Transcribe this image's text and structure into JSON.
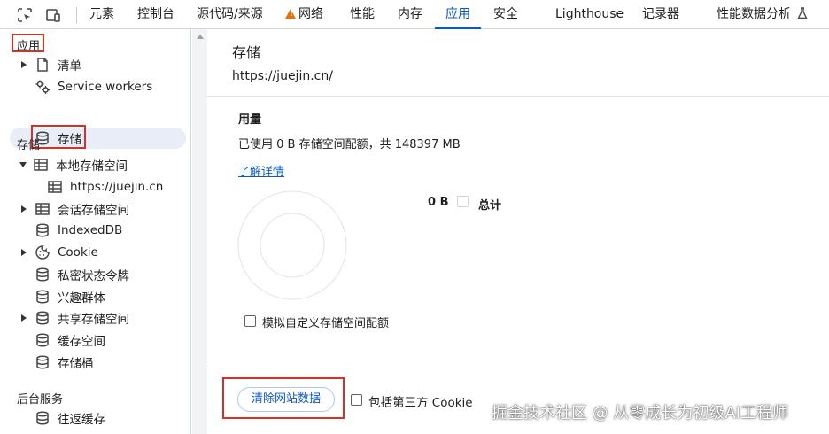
{
  "toolbar": {
    "tabs": [
      {
        "label": "元素"
      },
      {
        "label": "控制台"
      },
      {
        "label": "源代码/来源"
      },
      {
        "label": "网络"
      },
      {
        "label": "性能"
      },
      {
        "label": "内存"
      },
      {
        "label": "应用"
      },
      {
        "label": "安全"
      },
      {
        "label": "Lighthouse"
      },
      {
        "label": "记录器"
      },
      {
        "label": "性能数据分析"
      }
    ],
    "active_tab": "应用"
  },
  "sidebar": {
    "app_section": "应用",
    "app_items": [
      {
        "label": "清单"
      },
      {
        "label": "Service workers"
      },
      {
        "label": "存储"
      }
    ],
    "storage_section": "存储",
    "storage_items": [
      {
        "label": "本地存储空间"
      },
      {
        "label": "https://juejin.cn"
      },
      {
        "label": "会话存储空间"
      },
      {
        "label": "IndexedDB"
      },
      {
        "label": "Cookie"
      },
      {
        "label": "私密状态令牌"
      },
      {
        "label": "兴趣群体"
      },
      {
        "label": "共享存储空间"
      },
      {
        "label": "缓存空间"
      },
      {
        "label": "存储桶"
      }
    ],
    "background_section": "后台服务",
    "background_items": [
      {
        "label": "往返缓存"
      }
    ]
  },
  "main": {
    "title": "存储",
    "origin": "https://juejin.cn/",
    "usage": {
      "heading": "用量",
      "summary": "已使用 0 B 存储空间配额，共 148397 MB",
      "learn_more": "了解详情",
      "legend_value": "0 B",
      "legend_label": "总计"
    },
    "simulate_quota_label": "模拟自定义存储空间配额",
    "clear_button": "清除网站数据",
    "include_third_party_label": "包括第三方 Cookie"
  },
  "watermark": "掘金技术社区 @ 从零成长为初级AI工程师",
  "colors": {
    "accent": "#0b57d0",
    "annotation_red": "#d93025",
    "warning": "#e37400"
  }
}
